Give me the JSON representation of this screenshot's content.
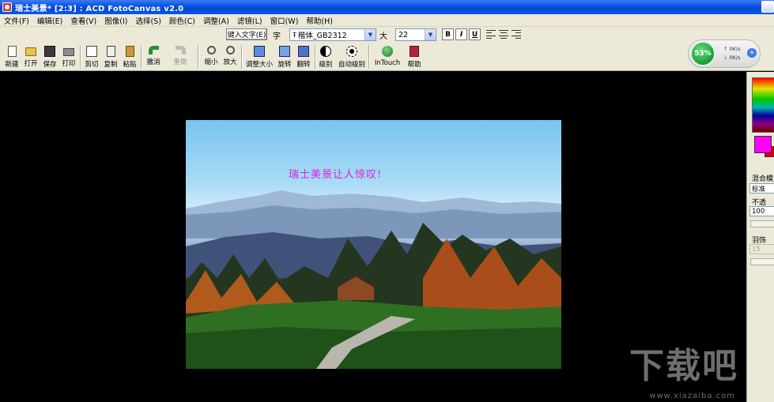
{
  "window": {
    "title": "瑞士美景* [2:3] : ACD FotoCanvas v2.0"
  },
  "menu": [
    "文件(F)",
    "编辑(E)",
    "查看(V)",
    "图像(I)",
    "选择(S)",
    "颜色(C)",
    "调整(A)",
    "滤镜(L)",
    "窗口(W)",
    "帮助(H)"
  ],
  "textbar": {
    "enter_text_label": "键入文字(E)",
    "font_label": "字",
    "font_value": "楷体_GB2312",
    "size_label": "大",
    "size_value": "22",
    "bold": "B",
    "italic": "I",
    "underline": "U"
  },
  "toolbar": {
    "new": "新建",
    "open": "打开",
    "save": "保存",
    "print": "打印",
    "cut": "剪切",
    "copy": "复制",
    "paste": "粘贴",
    "undo": "撤消",
    "redo": "重做",
    "zoom_out": "缩小",
    "zoom_in": "放大",
    "resize": "调整大小",
    "rotate": "旋转",
    "flip": "翻转",
    "levels": "级别",
    "auto_levels": "自动级别",
    "intouch": "InTouch",
    "help": "帮助"
  },
  "net_widget": {
    "percent": "53%",
    "up": "0K/s",
    "down": "0K/s"
  },
  "canvas": {
    "caption": "瑞士美景让人惊叹!"
  },
  "panel": {
    "blend_mode_label": "混合模式",
    "blend_mode_value": "标准",
    "opacity_label": "不透",
    "opacity_value": "100",
    "feather_label": "羽饰",
    "feather_value": "15"
  },
  "colors": {
    "foreground": "#ff00ff",
    "background": "#e00000",
    "caption": "#d91fd9"
  },
  "watermark": {
    "text": "下载吧",
    "url": "www.xiazaiba.com"
  }
}
